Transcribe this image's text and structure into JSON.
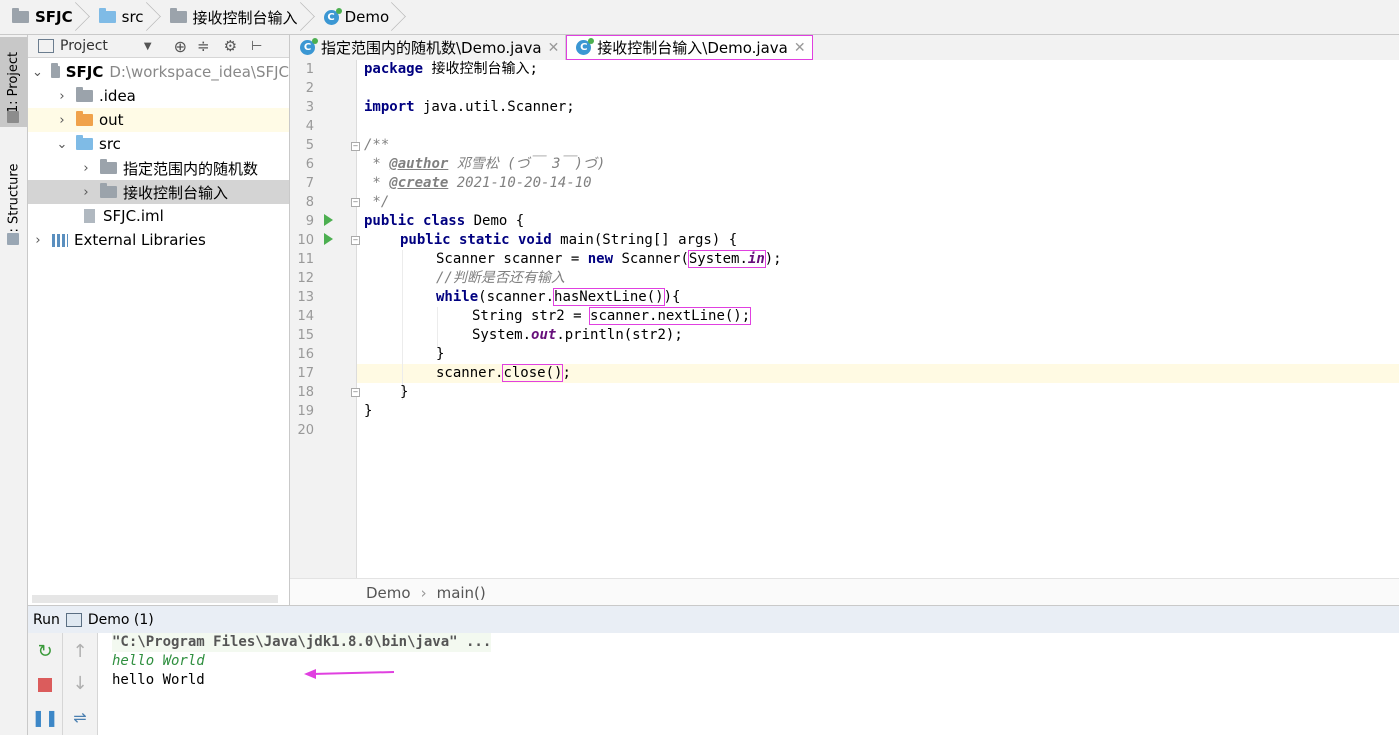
{
  "navbar": {
    "project": "SFJC",
    "src": "src",
    "package": "接收控制台输入",
    "class": "Demo"
  },
  "left_strip": {
    "project_tab": "1: Project",
    "structure_tab": "Z: Structure"
  },
  "project_panel": {
    "title": "Project",
    "tree": {
      "root_name": "SFJC",
      "root_path": "D:\\workspace_idea\\SFJC",
      "idea": ".idea",
      "out": "out",
      "src": "src",
      "pkg1": "指定范围内的随机数",
      "pkg2": "接收控制台输入",
      "iml": "SFJC.iml",
      "ext": "External Libraries"
    }
  },
  "tabs": [
    {
      "label": "指定范围内的随机数\\Demo.java"
    },
    {
      "label": "接收控制台输入\\Demo.java"
    }
  ],
  "editor": {
    "line_numbers": [
      "1",
      "2",
      "3",
      "4",
      "5",
      "6",
      "7",
      "8",
      "9",
      "10",
      "11",
      "12",
      "13",
      "14",
      "15",
      "16",
      "17",
      "18",
      "19",
      "20"
    ],
    "code": {
      "l1_kw": "package",
      "l1_rest": " 接收控制台输入;",
      "l3_kw": "import",
      "l3_rest": " java.util.Scanner;",
      "l5": "/**",
      "l6_pre": " * ",
      "l6_tag": "@author",
      "l6_rest": " 邓雪松 (づ￣ 3￣)づ)",
      "l7_pre": " * ",
      "l7_tag": "@create",
      "l7_rest": " 2021-10-20-14-10",
      "l8": " */",
      "l9_kw": "public class",
      "l9_rest": " Demo {",
      "l10_kw": "public static void",
      "l10_rest": " main(String[] args) {",
      "l11_a": "Scanner scanner = ",
      "l11_kw": "new",
      "l11_b": " Scanner(",
      "l11_box_a": "System.",
      "l11_box_st": "in",
      "l11_c": ");",
      "l12": "//判断是否还有输入",
      "l13_kw": "while",
      "l13_a": "(scanner.",
      "l13_box": "hasNextLine()",
      "l13_b": "){",
      "l14_a": "String str2 = ",
      "l14_box": "scanner.nextLine();",
      "l15_a": "System.",
      "l15_st": "out",
      "l15_b": ".println(str2);",
      "l16": "}",
      "l17_a": "scanner.",
      "l17_box": "close()",
      "l17_b": ";",
      "l18": "}",
      "l19": "}"
    }
  },
  "editor_breadcrumb": {
    "class": "Demo",
    "method": "main()"
  },
  "run_panel": {
    "label": "Run",
    "config": "Demo (1)",
    "console": {
      "cmd": "\"C:\\Program Files\\Java\\jdk1.8.0\\bin\\java\" ...",
      "input_echo": "hello World",
      "output": "hello World"
    }
  },
  "colors": {
    "highlight_box": "#e040e0",
    "annotation_arrow": "#e040e0",
    "keyword": "#000080",
    "console_green": "#2f8f3f"
  }
}
